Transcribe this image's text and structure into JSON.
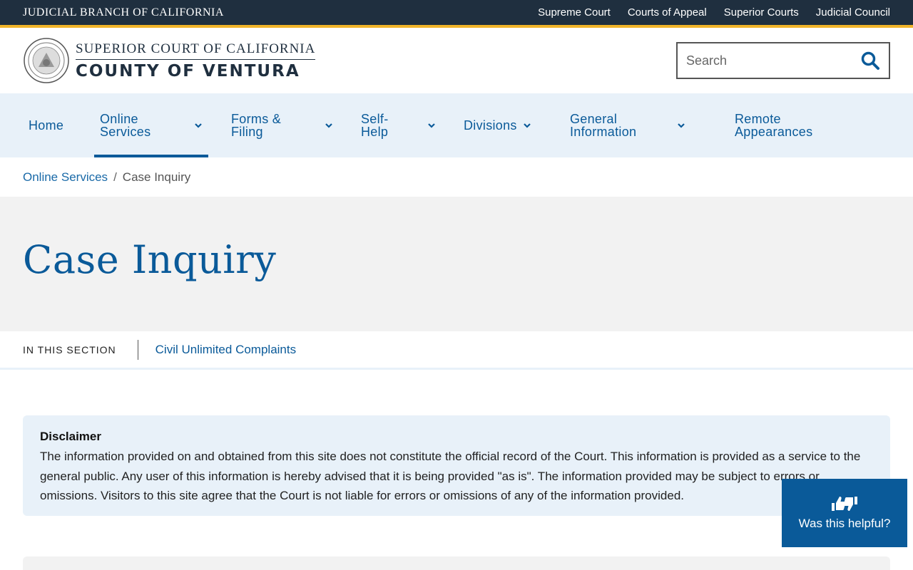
{
  "topbar": {
    "brand": "JUDICIAL BRANCH OF CALIFORNIA",
    "links": [
      "Supreme Court",
      "Courts of Appeal",
      "Superior Courts",
      "Judicial Council"
    ]
  },
  "header": {
    "logo_line1": "SUPERIOR COURT OF CALIFORNIA",
    "logo_line2": "COUNTY OF VENTURA",
    "search_placeholder": "Search"
  },
  "nav": {
    "home": "Home",
    "online_services": "Online Services",
    "forms_filing": "Forms & Filing",
    "self_help": "Self-Help",
    "divisions": "Divisions",
    "general_information": "General Information",
    "remote_appearances": "Remote Appearances"
  },
  "breadcrumb": {
    "parent": "Online Services",
    "separator": "/",
    "current": "Case Inquiry"
  },
  "page": {
    "title": "Case Inquiry"
  },
  "section_nav": {
    "label": "IN THIS SECTION",
    "links": [
      "Civil Unlimited Complaints"
    ]
  },
  "disclaimer": {
    "title": "Disclaimer",
    "body": "The information provided on and obtained from this site does not constitute the official record of the Court. This information is provided as a service to the general public. Any user of this information is hereby advised that it is being provided \"as is\". The information provided may be subject to errors or omissions. Visitors to this site agree that the Court is not liable for errors or omissions of any of the information provided."
  },
  "feedback": {
    "label": "Was this helpful?"
  },
  "colors": {
    "topbar_bg": "#1f2f3f",
    "accent_gold": "#f0b429",
    "brand_blue": "#0a5a99",
    "nav_bg": "#e8f1f9",
    "hero_bg": "#f2f2f2"
  }
}
